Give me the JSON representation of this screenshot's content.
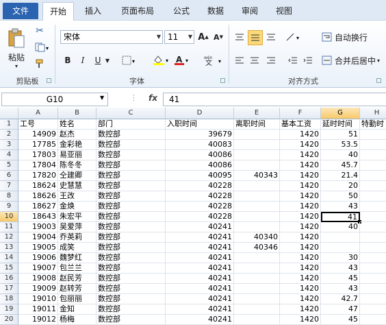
{
  "tabs": [
    "文件",
    "开始",
    "插入",
    "页面布局",
    "公式",
    "数据",
    "审阅",
    "视图"
  ],
  "ribbon": {
    "clipboard": {
      "paste_label": "粘贴",
      "group_label": "剪贴板"
    },
    "font": {
      "font_name": "宋体",
      "font_size": "11",
      "group_label": "字体",
      "bold": "B",
      "italic": "I",
      "underline": "U"
    },
    "alignment": {
      "wrap_label": "自动换行",
      "merge_label": "合并后居中",
      "group_label": "对齐方式"
    }
  },
  "formula_bar": {
    "name_box": "G10",
    "fx": "fx",
    "value": "41"
  },
  "column_headers": [
    "A",
    "B",
    "C",
    "D",
    "E",
    "F",
    "G",
    "H"
  ],
  "selected_column": "G",
  "selected_row": 10,
  "rows": [
    {
      "n": "1",
      "a": "工号",
      "b": "姓名",
      "c": "部门",
      "d": "入职时间",
      "e": "离职时间",
      "f": "基本工资",
      "g": "延时时间",
      "h": "特勤时"
    },
    {
      "n": "2",
      "a": "14909",
      "b": "赵杰",
      "c": "数控部",
      "d": "39679",
      "e": "",
      "f": "1420",
      "g": "51",
      "h": ""
    },
    {
      "n": "3",
      "a": "17785",
      "b": "金彩艳",
      "c": "数控部",
      "d": "40083",
      "e": "",
      "f": "1420",
      "g": "53.5",
      "h": ""
    },
    {
      "n": "4",
      "a": "17803",
      "b": "易亚丽",
      "c": "数控部",
      "d": "40086",
      "e": "",
      "f": "1420",
      "g": "40",
      "h": ""
    },
    {
      "n": "5",
      "a": "17804",
      "b": "陈冬冬",
      "c": "数控部",
      "d": "40086",
      "e": "",
      "f": "1420",
      "g": "45.7",
      "h": ""
    },
    {
      "n": "6",
      "a": "17820",
      "b": "仝建卿",
      "c": "数控部",
      "d": "40095",
      "e": "40343",
      "f": "1420",
      "g": "21.4",
      "h": ""
    },
    {
      "n": "7",
      "a": "18624",
      "b": "史慧慧",
      "c": "数控部",
      "d": "40228",
      "e": "",
      "f": "1420",
      "g": "20",
      "h": ""
    },
    {
      "n": "8",
      "a": "18626",
      "b": "王改",
      "c": "数控部",
      "d": "40228",
      "e": "",
      "f": "1420",
      "g": "50",
      "h": ""
    },
    {
      "n": "9",
      "a": "18627",
      "b": "金焕",
      "c": "数控部",
      "d": "40228",
      "e": "",
      "f": "1420",
      "g": "43",
      "h": ""
    },
    {
      "n": "10",
      "a": "18643",
      "b": "朱宏平",
      "c": "数控部",
      "d": "40228",
      "e": "",
      "f": "1420",
      "g": "41",
      "h": ""
    },
    {
      "n": "11",
      "a": "19003",
      "b": "吴爱萍",
      "c": "数控部",
      "d": "40241",
      "e": "",
      "f": "1420",
      "g": "40",
      "h": ""
    },
    {
      "n": "12",
      "a": "19004",
      "b": "乔英莉",
      "c": "数控部",
      "d": "40241",
      "e": "40340",
      "f": "1420",
      "g": "",
      "h": ""
    },
    {
      "n": "13",
      "a": "19005",
      "b": "成笑",
      "c": "数控部",
      "d": "40241",
      "e": "40346",
      "f": "1420",
      "g": "",
      "h": ""
    },
    {
      "n": "14",
      "a": "19006",
      "b": "魏梦红",
      "c": "数控部",
      "d": "40241",
      "e": "",
      "f": "1420",
      "g": "30",
      "h": ""
    },
    {
      "n": "15",
      "a": "19007",
      "b": "包兰兰",
      "c": "数控部",
      "d": "40241",
      "e": "",
      "f": "1420",
      "g": "43",
      "h": ""
    },
    {
      "n": "16",
      "a": "19008",
      "b": "赵民芳",
      "c": "数控部",
      "d": "40241",
      "e": "",
      "f": "1420",
      "g": "45",
      "h": ""
    },
    {
      "n": "17",
      "a": "19009",
      "b": "赵转芳",
      "c": "数控部",
      "d": "40241",
      "e": "",
      "f": "1420",
      "g": "43",
      "h": ""
    },
    {
      "n": "18",
      "a": "19010",
      "b": "包丽丽",
      "c": "数控部",
      "d": "40241",
      "e": "",
      "f": "1420",
      "g": "42.7",
      "h": ""
    },
    {
      "n": "19",
      "a": "19011",
      "b": "金知",
      "c": "数控部",
      "d": "40241",
      "e": "",
      "f": "1420",
      "g": "47",
      "h": ""
    },
    {
      "n": "20",
      "a": "19012",
      "b": "杨梅",
      "c": "数控部",
      "d": "40241",
      "e": "",
      "f": "1420",
      "g": "45",
      "h": ""
    }
  ]
}
